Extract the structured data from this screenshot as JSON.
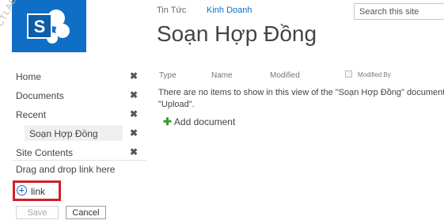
{
  "watermark": "CTLAB",
  "top_nav": [
    "Tin Tức",
    "Kinh Doanh"
  ],
  "search": {
    "placeholder": "Search this site"
  },
  "page_title": "Soạn Hợp Đồng",
  "left_nav": {
    "items": [
      {
        "label": "Home"
      },
      {
        "label": "Documents"
      },
      {
        "label": "Recent"
      },
      {
        "label": "Soạn Hợp Đồng"
      },
      {
        "label": "Site Contents"
      }
    ],
    "remove_glyph": "✖",
    "drag_hint": "Drag and drop link here",
    "link_label": "link",
    "save_label": "Save",
    "cancel_label": "Cancel"
  },
  "list": {
    "columns": [
      "Type",
      "Name",
      "Modified",
      "Modified By"
    ],
    "empty_line1": "There are no items to show in this view of the \"Soạn Hợp Đồng\" document library. To add a new item, click \"New\" or",
    "empty_line2": "\"Upload\".",
    "add_document": "Add document"
  },
  "colors": {
    "accent": "#0f6fc6",
    "highlight": "#d21f2a",
    "add": "#3a9a36"
  }
}
